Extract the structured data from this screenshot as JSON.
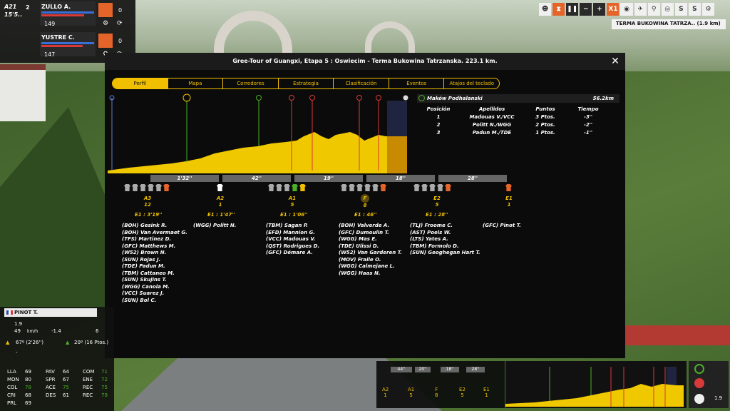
{
  "top_left": {
    "race_code": "A21",
    "race_time": "15'5..",
    "rider_count": "2",
    "riders": [
      {
        "name": "ZULLO A.",
        "value": "149",
        "count": "0"
      },
      {
        "name": "YUSTRE C.",
        "value": "147",
        "count": "0"
      }
    ]
  },
  "toolbar": {
    "speed": "X1",
    "s1": "S",
    "s2": "S"
  },
  "finish": "TERMA BUKOWINA TATRZA.. (1.9 km)",
  "modal": {
    "title": "Gree-Tour of Guangxi, Etapa 5 : Oswiecim - Terma Bukowina Tatrzanska. 223.1 km.",
    "tabs": [
      "Perfil",
      "Mapa",
      "Corredores",
      "Estrategia",
      "Clasificación",
      "Eventos",
      "Atajos del teclado"
    ],
    "sprint": {
      "name": "Maków Podhalanski",
      "distance": "56.2km",
      "headers": [
        "Posición",
        "Apellidos",
        "Puntos",
        "Tiempo"
      ],
      "rows": [
        [
          "1",
          "Madouas V./VCC",
          "3 Ptos.",
          "-3''"
        ],
        [
          "2",
          "Politt N./WGG",
          "2 Ptos.",
          "-2''"
        ],
        [
          "3",
          "Padun M./TDE",
          "1 Ptos.",
          "-1''"
        ]
      ]
    },
    "gaps": [
      "1'32''",
      "42''",
      "19''",
      "18''",
      "28''"
    ],
    "groups": [
      {
        "label": "A3",
        "count": "12",
        "time": "E1 : 3'19''",
        "riders": [
          "(BOH) Gesink R.",
          "(BOH) Van Avermaet G.",
          "(TFS) Martinez D.",
          "(GFC) Matthews M.",
          "(W52) Brown N.",
          "(SUN) Rojas J.",
          "(TDE) Padun M.",
          "(TBM) Cattaneo M.",
          "(SUN) Skujins T.",
          "(WGG) Canola M.",
          "(VCC) Suarez J.",
          "(SUN) Bol C."
        ]
      },
      {
        "label": "A2",
        "count": "1",
        "time": "E1 : 1'47''",
        "riders": [
          "(WGG) Politt N."
        ]
      },
      {
        "label": "A1",
        "count": "5",
        "time": "E1 : 1'06''",
        "riders": [
          "(TBM) Sagan P.",
          "(EFD) Mannion G.",
          "(VCC) Madouas V.",
          "(QST) Rodrigues D.",
          "(GFC) Démare A."
        ]
      },
      {
        "label": "F",
        "count": "8",
        "time": "E1 : 46''",
        "riders": [
          "(BOH) Valverde A.",
          "(GFC) Dumoulin T.",
          "(WGG) Mas E.",
          "(TDE) Ulissi D.",
          "(W52) Van Garderen T.",
          "(MOV) Fraile O.",
          "(WGG) Calmejane L.",
          "(WGG) Haas N."
        ]
      },
      {
        "label": "E2",
        "count": "5",
        "time": "E1 : 28''",
        "riders": [
          "(TLJ) Froome C.",
          "(AST) Poels W.",
          "(LTS) Yates A.",
          "(TBM) Formolo D.",
          "(SUN) Geoghegan Hart T."
        ]
      },
      {
        "label": "E1",
        "count": "1",
        "time": "",
        "riders": [
          "(GFC) Pinot T."
        ]
      }
    ]
  },
  "bottom_left": {
    "name": "PINOT T.",
    "dist": "1.9",
    "speed": "49",
    "speed_unit": "km/h",
    "grade": "-1.4",
    "pos": "6",
    "gc": "67º (2'26'')",
    "points": "20º (16 Ptos.)",
    "dash": "-",
    "stats": [
      [
        "LLA",
        "69"
      ],
      [
        "MON",
        "80"
      ],
      [
        "COL",
        "78"
      ],
      [
        "CRI",
        "68"
      ],
      [
        "PRL",
        "69"
      ],
      [
        "PAV",
        "64"
      ],
      [
        "SPR",
        "67"
      ],
      [
        "ACE",
        "75"
      ],
      [
        "DES",
        "61"
      ],
      [
        "COM",
        "71"
      ],
      [
        "ENE",
        "72"
      ],
      [
        "REC",
        "75"
      ],
      [
        "REC",
        "79"
      ]
    ]
  },
  "mini_groups": {
    "gaps": [
      "44''",
      "20''",
      "18''",
      "28''"
    ],
    "labels": [
      [
        "A2",
        "1"
      ],
      [
        "A1",
        "5"
      ],
      [
        "F",
        "8"
      ],
      [
        "E2",
        "5"
      ],
      [
        "E1",
        "1"
      ]
    ]
  },
  "mini_dist": "1.9"
}
